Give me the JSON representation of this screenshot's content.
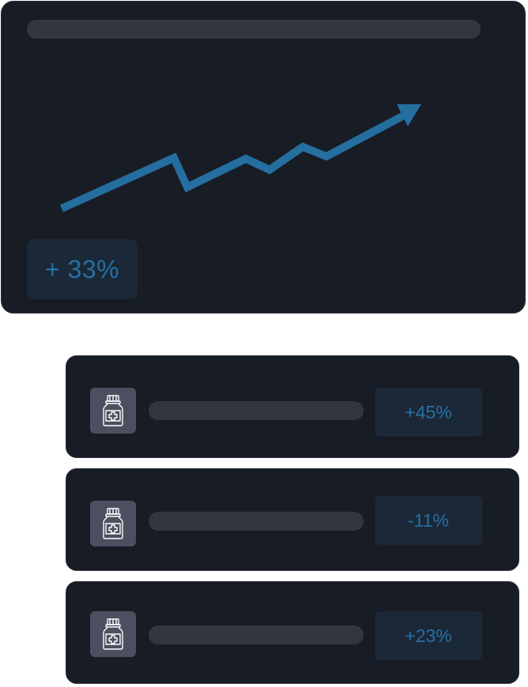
{
  "summary_card": {
    "growth_label": "+ 33%",
    "trend": {
      "points": [
        [
          78,
          264
        ],
        [
          220,
          200
        ],
        [
          237,
          237
        ],
        [
          311,
          201
        ],
        [
          341,
          215
        ],
        [
          383,
          186
        ],
        [
          413,
          198
        ],
        [
          517,
          143
        ]
      ],
      "arrow_head": [
        [
          502,
          132
        ],
        [
          533,
          132
        ],
        [
          516,
          160
        ]
      ],
      "color": "#256ea0"
    }
  },
  "items": [
    {
      "icon": "medicine-bottle-icon",
      "change": "+45%"
    },
    {
      "icon": "medicine-bottle-icon",
      "change": "-11%"
    },
    {
      "icon": "medicine-bottle-icon",
      "change": "+23%"
    }
  ],
  "colors": {
    "card_bg": "#171c25",
    "card_border": "#2c313b",
    "placeholder_bar": "#323640",
    "badge_bg": "#1b2838",
    "accent": "#2770a3",
    "icon_tile": "#4b4f5f"
  }
}
